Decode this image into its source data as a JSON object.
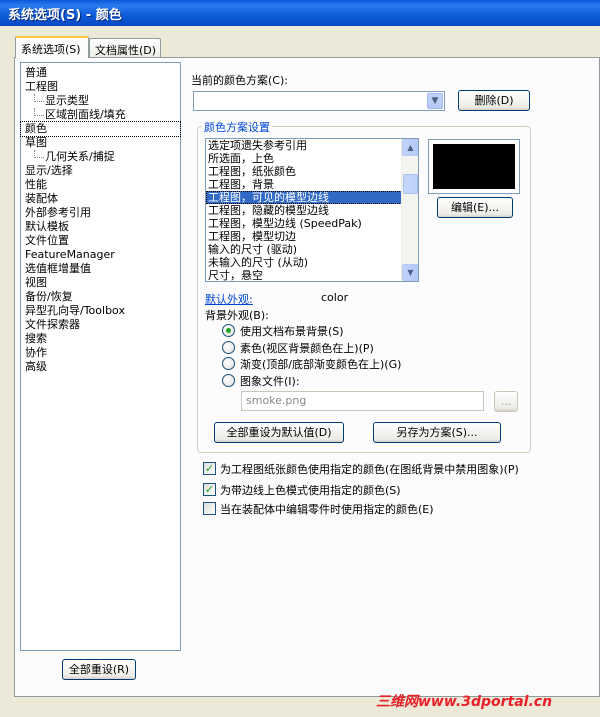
{
  "window": {
    "title": "系统选项(S) - 颜色"
  },
  "tabs": [
    {
      "label": "系统选项(S)",
      "active": true
    },
    {
      "label": "文档属性(D)",
      "active": false
    }
  ],
  "tree": {
    "items": [
      {
        "label": "普通",
        "child": false
      },
      {
        "label": "工程图",
        "child": false
      },
      {
        "label": "显示类型",
        "child": true
      },
      {
        "label": "区域剖面线/填充",
        "child": true
      },
      {
        "label": "颜色",
        "child": false,
        "selected": true
      },
      {
        "label": "草图",
        "child": false
      },
      {
        "label": "几何关系/捕捉",
        "child": true
      },
      {
        "label": "显示/选择",
        "child": false
      },
      {
        "label": "性能",
        "child": false
      },
      {
        "label": "装配体",
        "child": false
      },
      {
        "label": "外部参考引用",
        "child": false
      },
      {
        "label": "默认模板",
        "child": false
      },
      {
        "label": "文件位置",
        "child": false
      },
      {
        "label": "FeatureManager",
        "child": false
      },
      {
        "label": "选值框增量值",
        "child": false
      },
      {
        "label": "视图",
        "child": false
      },
      {
        "label": "备份/恢复",
        "child": false
      },
      {
        "label": "异型孔向导/Toolbox",
        "child": false
      },
      {
        "label": "文件探索器",
        "child": false
      },
      {
        "label": "搜索",
        "child": false
      },
      {
        "label": "协作",
        "child": false
      },
      {
        "label": "高级",
        "child": false
      }
    ],
    "reset_all_label": "全部重设(R)"
  },
  "scheme": {
    "label": "当前的颜色方案(C):",
    "value": "",
    "delete_label": "删除(D)"
  },
  "settings": {
    "group_label": "颜色方案设置",
    "list_items": [
      "选定项遗失参考引用",
      "所选面，上色",
      "工程图，纸张颜色",
      "工程图，背景",
      "工程图，可见的模型边线",
      "工程图，隐藏的模型边线",
      "工程图，模型边线 (SpeedPak)",
      "工程图，模型切边",
      "输入的尺寸 (驱动)",
      "未输入的尺寸 (从动)",
      "尺寸，悬空"
    ],
    "selected_index": 4,
    "edit_label": "编辑(E)...",
    "preview_color": "#000000",
    "default_appearance_label": "默认外观:",
    "default_appearance_value": "color",
    "background_label": "背景外观(B):",
    "radio_options": [
      {
        "label": "使用文档布景背景(S)",
        "checked": true
      },
      {
        "label": "素色(视区背景颜色在上)(P)",
        "checked": false
      },
      {
        "label": "渐变(顶部/底部渐变颜色在上)(G)",
        "checked": false
      },
      {
        "label": "图象文件(I):",
        "checked": false
      }
    ],
    "image_file_value": "smoke.png",
    "browse_label": "...",
    "reset_defaults_label": "全部重设为默认值(D)",
    "save_as_label": "另存为方案(S)..."
  },
  "checkboxes": [
    {
      "label": "为工程图纸张颜色使用指定的颜色(在图纸背景中禁用图象)(P)",
      "checked": true
    },
    {
      "label": "为带边线上色模式使用指定的颜色(S)",
      "checked": true
    },
    {
      "label": "当在装配体中编辑零件时使用指定的颜色(E)",
      "checked": false
    }
  ],
  "watermark": "三维网www.3dportal.cn",
  "colors": {
    "accent": "#316AC5",
    "titlebar": "#0A56D8",
    "dialog_bg": "#ECE9D8"
  }
}
